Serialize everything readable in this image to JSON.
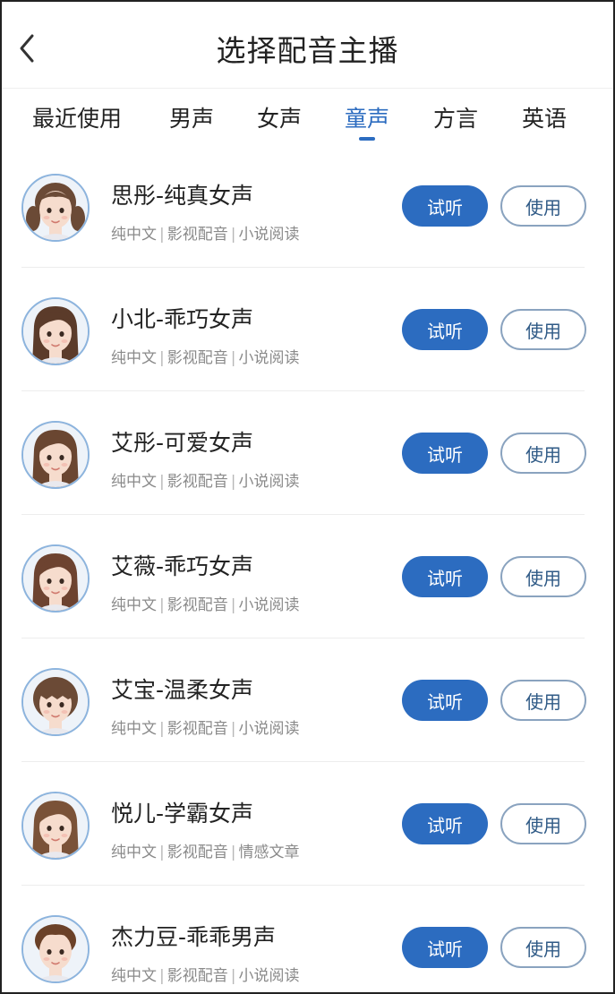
{
  "header": {
    "title": "选择配音主播"
  },
  "tabs": [
    {
      "label": "最近使用"
    },
    {
      "label": "男声"
    },
    {
      "label": "女声"
    },
    {
      "label": "童声"
    },
    {
      "label": "方言"
    },
    {
      "label": "英语"
    }
  ],
  "active_tab": "童声",
  "colors": {
    "accent": "#2c6cc0",
    "use_border": "#8aa3bf",
    "tag_text": "#8a8a8a",
    "avatar_ring": "#8cb4de"
  },
  "labels": {
    "listen": "试听",
    "use": "使用"
  },
  "voices": [
    {
      "name": "思彤-纯真女声",
      "tags": [
        "纯中文",
        "影视配音",
        "小说阅读"
      ],
      "hair": "#6b4a36",
      "style": "pigtails"
    },
    {
      "name": "小北-乖巧女声",
      "tags": [
        "纯中文",
        "影视配音",
        "小说阅读"
      ],
      "hair": "#5b3b2a",
      "style": "long"
    },
    {
      "name": "艾彤-可爱女声",
      "tags": [
        "纯中文",
        "影视配音",
        "小说阅读"
      ],
      "hair": "#6a4631",
      "style": "long"
    },
    {
      "name": "艾薇-乖巧女声",
      "tags": [
        "纯中文",
        "影视配音",
        "小说阅读"
      ],
      "hair": "#6d4330",
      "style": "long"
    },
    {
      "name": "艾宝-温柔女声",
      "tags": [
        "纯中文",
        "影视配音",
        "小说阅读"
      ],
      "hair": "#6b4a36",
      "style": "bangs"
    },
    {
      "name": "悦儿-学霸女声",
      "tags": [
        "纯中文",
        "影视配音",
        "情感文章"
      ],
      "hair": "#7a5238",
      "style": "long"
    },
    {
      "name": "杰力豆-乖乖男声",
      "tags": [
        "纯中文",
        "影视配音",
        "小说阅读"
      ],
      "hair": "#6b4128",
      "style": "short"
    }
  ]
}
